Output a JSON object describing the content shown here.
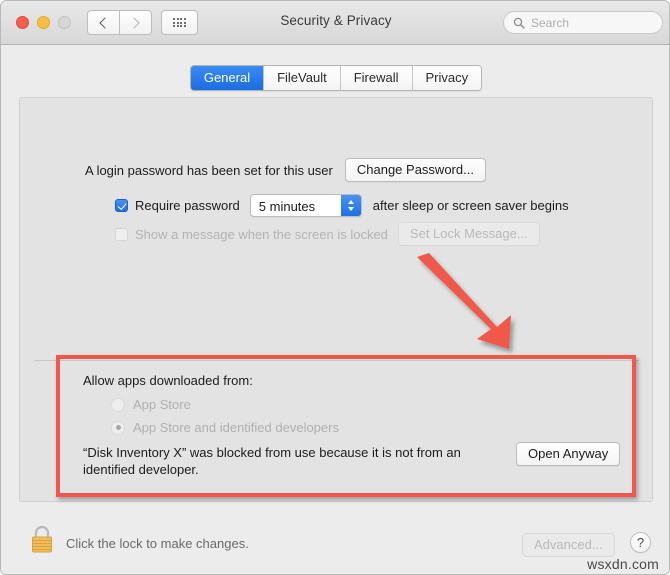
{
  "window": {
    "title": "Security & Privacy",
    "traffic_lights": [
      "close",
      "minimize",
      "zoom-disabled"
    ],
    "nav": {
      "back": "back-chevron",
      "forward": "forward-chevron",
      "grid": "show-all-grid"
    },
    "search": {
      "placeholder": "Search",
      "value": "",
      "icon": "search-icon"
    }
  },
  "tabs": [
    {
      "label": "General",
      "active": true
    },
    {
      "label": "FileVault",
      "active": false
    },
    {
      "label": "Firewall",
      "active": false
    },
    {
      "label": "Privacy",
      "active": false
    }
  ],
  "general": {
    "login_password_text": "A login password has been set for this user",
    "change_password_label": "Change Password...",
    "require_password": {
      "checked": true,
      "label": "Require password",
      "delay_value": "5 minutes",
      "suffix": "after sleep or screen saver begins"
    },
    "lock_message": {
      "checked": false,
      "label": "Show a message when the screen is locked",
      "button_label": "Set Lock Message...",
      "disabled": true
    },
    "allow_apps": {
      "label": "Allow apps downloaded from:",
      "options": [
        {
          "label": "App Store",
          "selected": false
        },
        {
          "label": "App Store and identified developers",
          "selected": true
        }
      ],
      "blocked_message": "“Disk Inventory X” was blocked from use because it is not from an identified developer.",
      "open_anyway_label": "Open Anyway"
    }
  },
  "footer": {
    "lock_icon": "padlock-closed-icon",
    "lock_text": "Click the lock to make changes.",
    "advanced_label": "Advanced...",
    "advanced_disabled": true,
    "help_label": "?"
  },
  "annotation": {
    "arrow_color": "#f0584a",
    "highlight_color": "#f0584a"
  },
  "watermark": "wsxdn.com"
}
